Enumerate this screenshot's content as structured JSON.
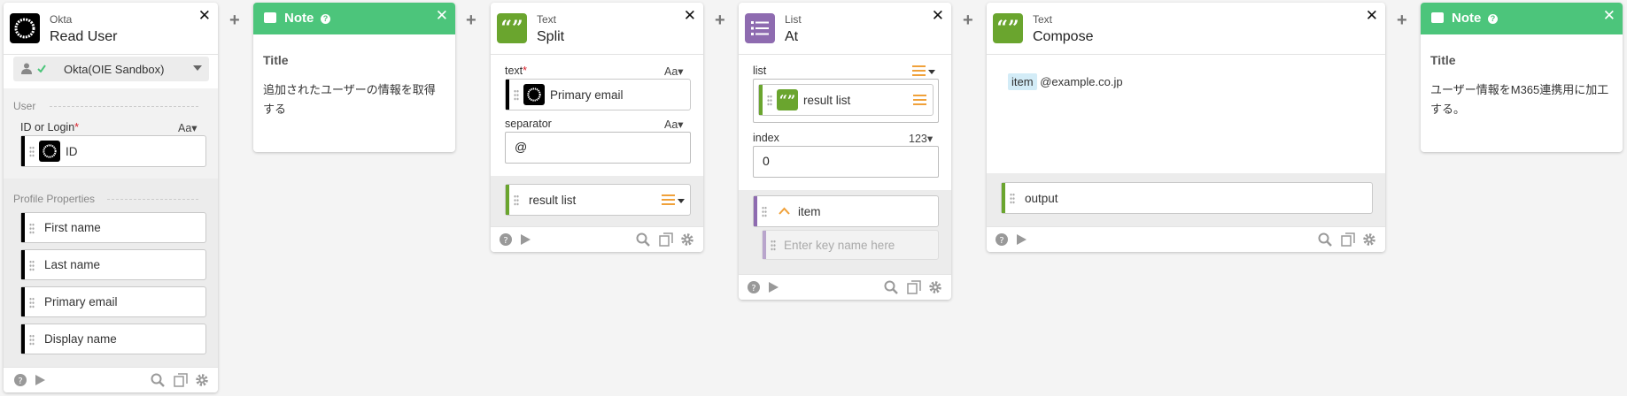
{
  "cards": {
    "okta": {
      "app": "Okta",
      "title": "Read User",
      "connection": "Okta(OIE Sandbox)",
      "user_section": "User",
      "id_label": "ID or Login",
      "id_type": "Aa▾",
      "id_value": "ID",
      "profile_section": "Profile Properties",
      "fields": [
        "First name",
        "Last name",
        "Primary email",
        "Display name"
      ]
    },
    "note1": {
      "label": "Note",
      "title": "Title",
      "body": "追加されたユーザーの情報を取得する"
    },
    "split": {
      "app": "Text",
      "title": "Split",
      "text_label": "text",
      "text_type": "Aa▾",
      "text_value": "Primary email",
      "separator_label": "separator",
      "separator_type": "Aa▾",
      "separator_value": "@",
      "output": "result list"
    },
    "at": {
      "app": "List",
      "title": "At",
      "list_label": "list",
      "list_value": "result list",
      "index_label": "index",
      "index_type": "123▾",
      "index_value": "0",
      "output": "item",
      "key_placeholder": "Enter key name here"
    },
    "compose": {
      "app": "Text",
      "title": "Compose",
      "token": "item",
      "suffix": "@example.co.jp",
      "output": "output"
    },
    "note2": {
      "label": "Note",
      "title": "Title",
      "body": "ユーザー情報をM365連携用に加工する。"
    }
  },
  "icons": {
    "close": "✕",
    "plus": "+",
    "help": "?"
  },
  "colors": {
    "note_green": "#4cc57b",
    "text_green": "#6aa52e",
    "list_purple": "#8e6bb0",
    "okta_black": "#000000",
    "list_orange": "#f0a13a"
  }
}
